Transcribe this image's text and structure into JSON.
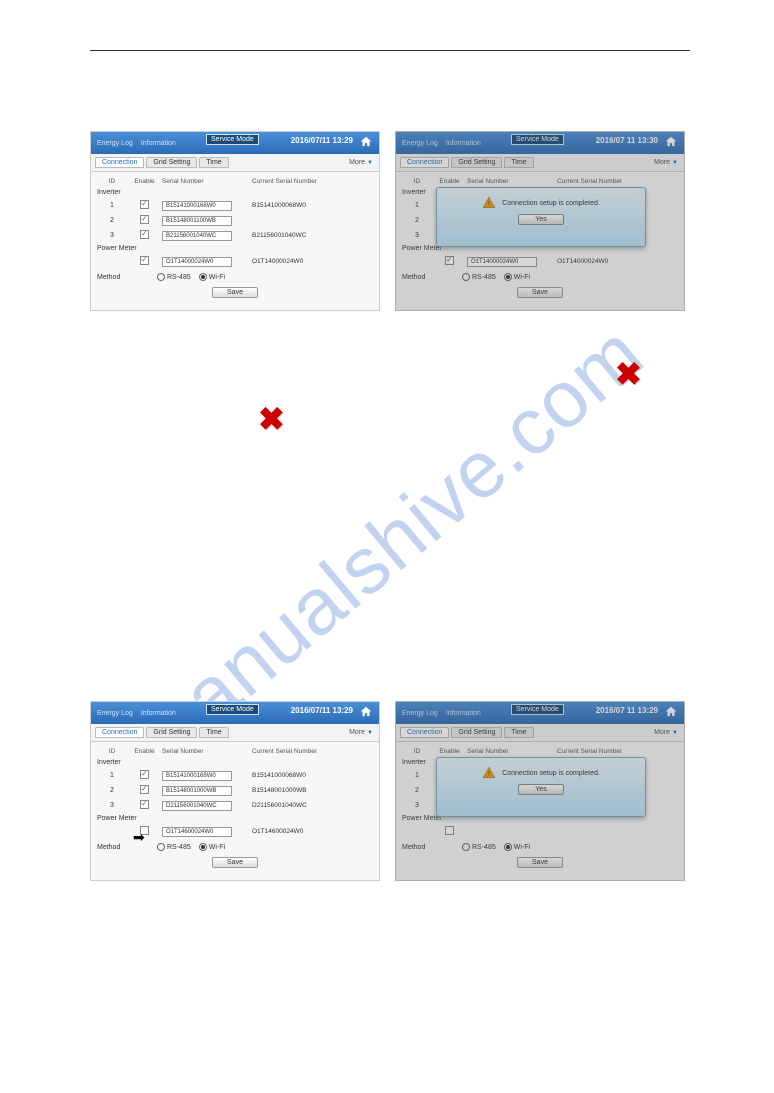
{
  "watermark": "manualshive.com",
  "panels": {
    "header": {
      "energy": "Energy Log",
      "info": "Information",
      "service_mode": "Service Mode",
      "ts_a": "2016/07/11 13:29",
      "ts_b": "2016/07 11 13:30",
      "ts_c": "2016/07/11 13:29",
      "ts_d": "2016/07 11 13:29"
    },
    "tabs": {
      "connection": "Connection",
      "grid": "Grid Setting",
      "time": "Time",
      "more": "More"
    },
    "thead": {
      "id": "ID",
      "enable": "Enable",
      "serial": "Serial Number",
      "current": "Current Serial Number"
    },
    "sections": {
      "inverter": "Inverter",
      "power_meter": "Power Meter",
      "method": "Method"
    },
    "rows": {
      "r1_id": "1",
      "r1_sn": "B15141000168W0",
      "r1_cur": "B15141000068W0",
      "r2_id": "2",
      "r2_sn": "B15148001100WB",
      "r2_cur": "",
      "r3_id": "3",
      "r3_sn": "B21156001040WC",
      "r3_cur": "B21156001040WC",
      "pm_sn": "O1T14000024W0",
      "pm_cur": "O1T14000024W0",
      "r2b_sn": "B15148001000WB",
      "r2b_cur": "B15148001000WB",
      "r3b_sn": "D21156001040WC",
      "r3b_cur": "D21156001040WC",
      "pmb_sn": "O1T14600024W0",
      "pmb_cur": "O1T14600024W0"
    },
    "radios": {
      "rs485": "RS-485",
      "wifi": "Wi-Fi"
    },
    "save": "Save",
    "dialog": {
      "msg": "Connection setup is completed.",
      "yes": "Yes"
    }
  }
}
